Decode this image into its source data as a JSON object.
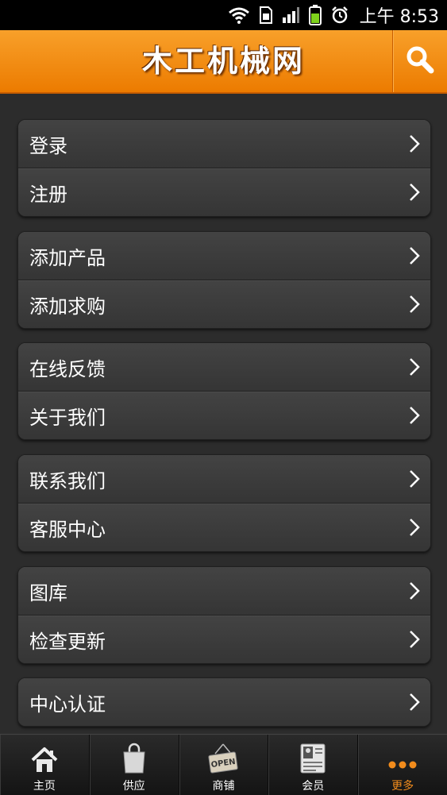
{
  "status_bar": {
    "time": "上午 8:53"
  },
  "header": {
    "title": "木工机械网",
    "search_icon": "search-icon"
  },
  "menu_groups": [
    {
      "items": [
        {
          "label": "登录"
        },
        {
          "label": "注册"
        }
      ]
    },
    {
      "items": [
        {
          "label": "添加产品"
        },
        {
          "label": "添加求购"
        }
      ]
    },
    {
      "items": [
        {
          "label": "在线反馈"
        },
        {
          "label": "关于我们"
        }
      ]
    },
    {
      "items": [
        {
          "label": "联系我们"
        },
        {
          "label": "客服中心"
        }
      ]
    },
    {
      "items": [
        {
          "label": "图库"
        },
        {
          "label": "检查更新"
        }
      ]
    },
    {
      "items": [
        {
          "label": "中心认证"
        }
      ]
    }
  ],
  "tabs": [
    {
      "label": "主页",
      "icon": "home-icon"
    },
    {
      "label": "供应",
      "icon": "shopping-bag-icon"
    },
    {
      "label": "商铺",
      "icon": "open-sign-icon",
      "sign_text": "OPEN"
    },
    {
      "label": "会员",
      "icon": "member-card-icon"
    },
    {
      "label": "更多",
      "icon": "more-dots-icon",
      "active": true
    }
  ],
  "colors": {
    "accent": "#f28c1c",
    "header": "#ec7b00",
    "background": "#2c2c2c"
  }
}
